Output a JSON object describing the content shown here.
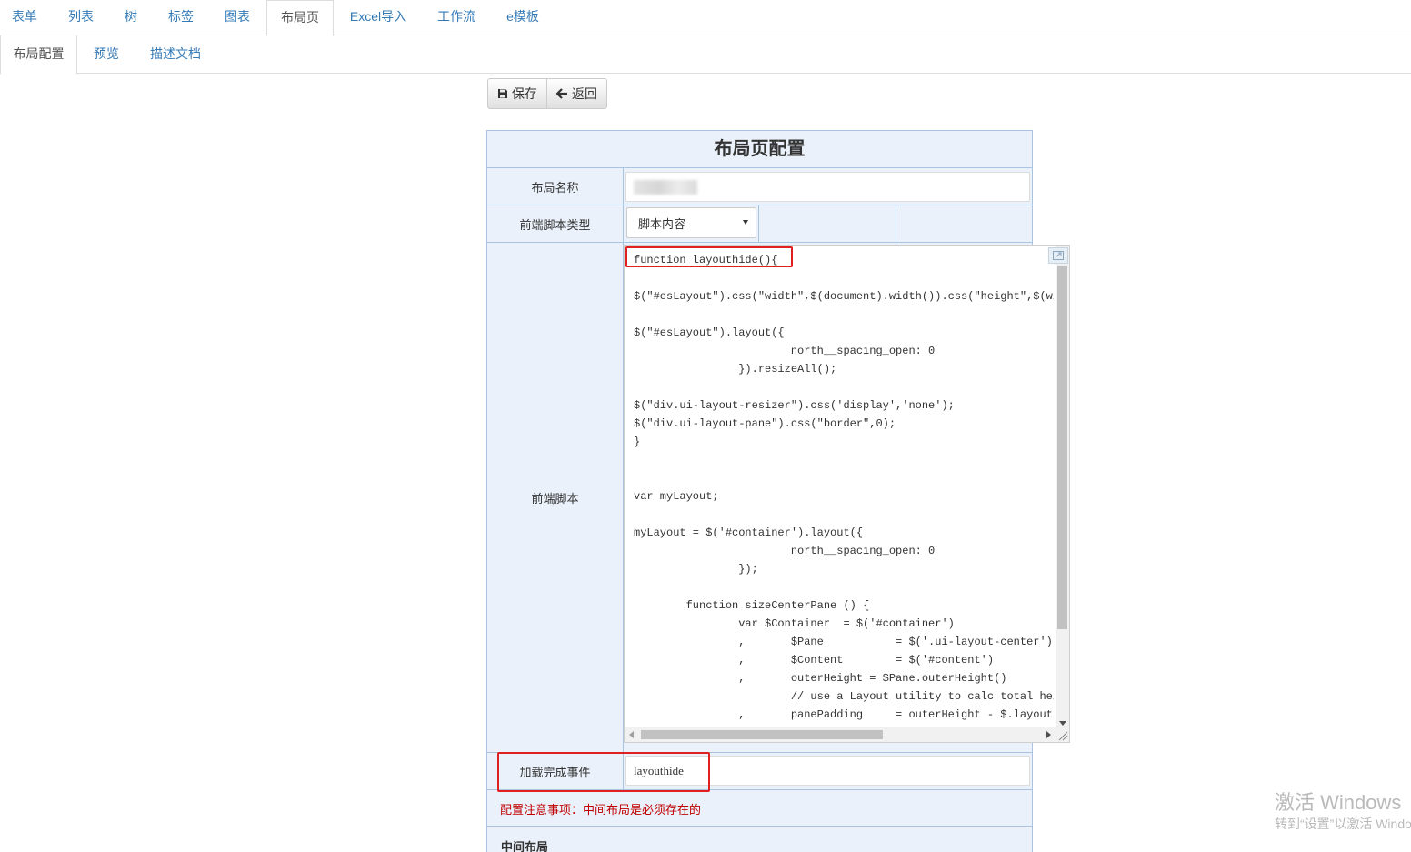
{
  "top_tabs": [
    {
      "label": "表单"
    },
    {
      "label": "列表"
    },
    {
      "label": "树"
    },
    {
      "label": "标签"
    },
    {
      "label": "图表"
    },
    {
      "label": "布局页"
    },
    {
      "label": "Excel导入"
    },
    {
      "label": "工作流"
    },
    {
      "label": "e模板"
    }
  ],
  "top_tabs_active": "布局页",
  "sub_tabs": [
    {
      "label": "布局配置"
    },
    {
      "label": "预览"
    },
    {
      "label": "描述文档"
    }
  ],
  "sub_tabs_active": "布局配置",
  "toolbar": {
    "save_label": "保存",
    "back_label": "返回",
    "save_icon": "floppy-disk-icon",
    "back_icon": "arrow-left-icon"
  },
  "form": {
    "title": "布局页配置",
    "layout_name_label": "布局名称",
    "layout_name_value": "",
    "script_type_label": "前端脚本类型",
    "script_type_value": "脚本内容",
    "script_label": "前端脚本",
    "load_event_label": "加载完成事件",
    "load_event_value": "layouthide",
    "note": "配置注意事项：中间布局是必须存在的",
    "section_label": "中间布局"
  },
  "editor": {
    "lines": [
      "function layouthide(){",
      "",
      "$(\"#esLayout\").css(\"width\",$(document).width()).css(\"height\",$(win",
      "",
      "$(\"#esLayout\").layout({",
      "                        north__spacing_open: 0",
      "                }).resizeAll();",
      "",
      "$(\"div.ui-layout-resizer\").css('display','none');",
      "$(\"div.ui-layout-pane\").css(\"border\",0);",
      "}",
      "",
      "",
      "var myLayout;",
      "",
      "myLayout = $('#container').layout({",
      "                        north__spacing_open: 0",
      "                });",
      "",
      "        function sizeCenterPane () {",
      "                var $Container  = $('#container')",
      "                ,       $Pane           = $('.ui-layout-center')",
      "                ,       $Content        = $('#content')",
      "                ,       outerHeight = $Pane.outerHeight()",
      "                        // use a Layout utility to calc total heig",
      "                ,       panePadding     = outerHeight - $.layout.c"
    ]
  },
  "colors": {
    "link": "#337ab7",
    "panel_bg": "#eaf1fa",
    "panel_border": "#a9c3e0",
    "highlight": "#e02020",
    "note": "#c00000"
  },
  "watermark": {
    "line1": "激活 Windows",
    "line2": "转到“设置”以激活 Windows。"
  }
}
